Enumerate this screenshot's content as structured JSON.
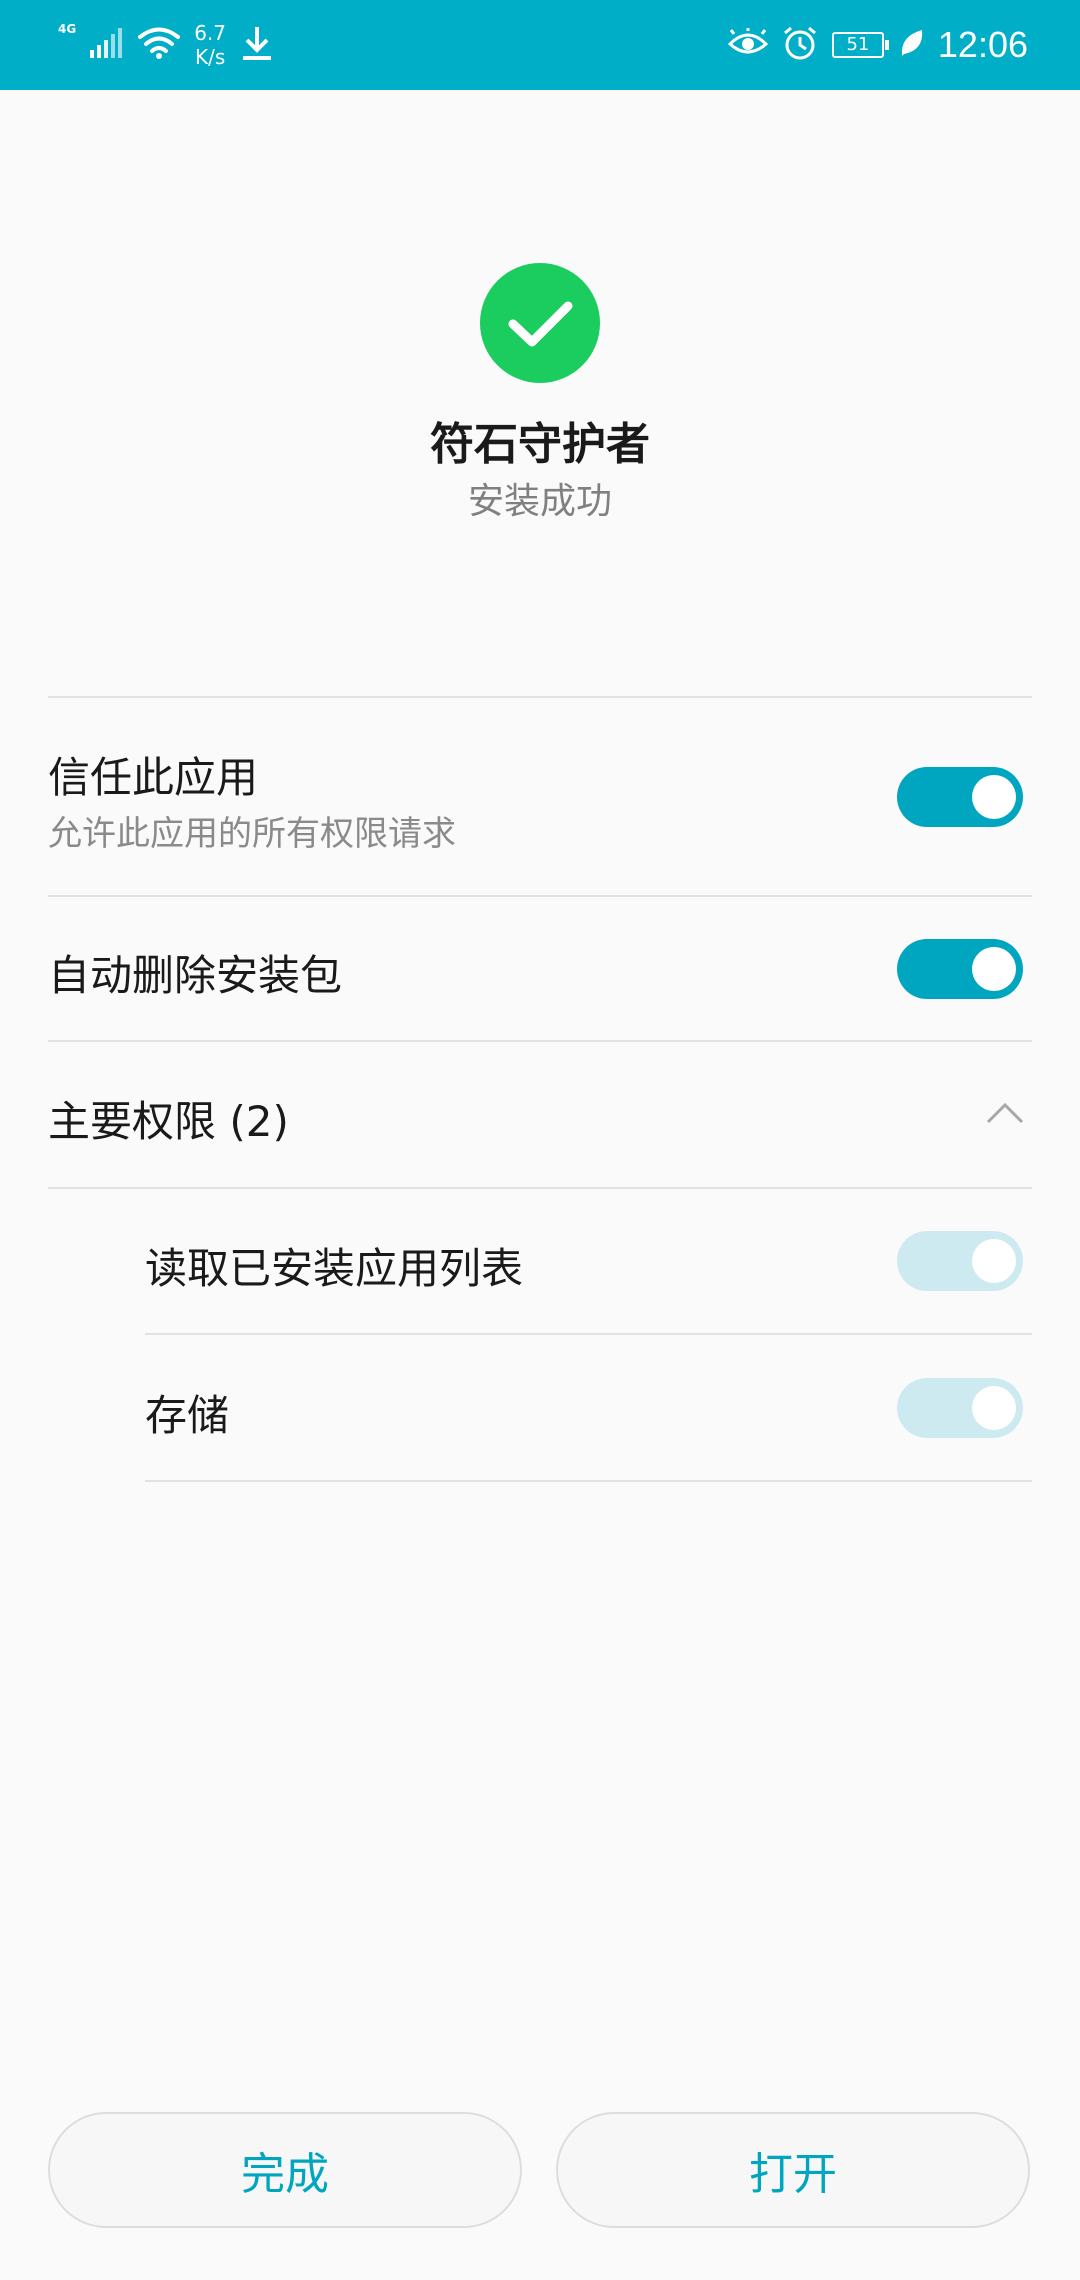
{
  "status_bar": {
    "network_type": "4G",
    "speed_value": "6.7",
    "speed_unit": "K/s",
    "battery": "51",
    "time": "12:06",
    "background_color": "#00aec7",
    "icons": [
      "signal-icon",
      "wifi-icon",
      "download-icon",
      "eye-icon",
      "alarm-icon",
      "battery-icon",
      "leaf-icon"
    ]
  },
  "header": {
    "app_name": "符石守护者",
    "status": "安装成功",
    "success_color": "#1bcc5e",
    "icon": "check-icon"
  },
  "settings": {
    "trust": {
      "title": "信任此应用",
      "subtitle": "允许此应用的所有权限请求",
      "enabled": true
    },
    "auto_delete": {
      "title": "自动删除安装包",
      "enabled": true
    }
  },
  "permissions": {
    "title": "主要权限 (2)",
    "expanded": true,
    "items": [
      {
        "label": "读取已安装应用列表",
        "enabled": true,
        "disabled": true
      },
      {
        "label": "存储",
        "enabled": true,
        "disabled": true
      }
    ]
  },
  "buttons": {
    "done": "完成",
    "open": "打开"
  },
  "accent_color": "#00a5c0"
}
